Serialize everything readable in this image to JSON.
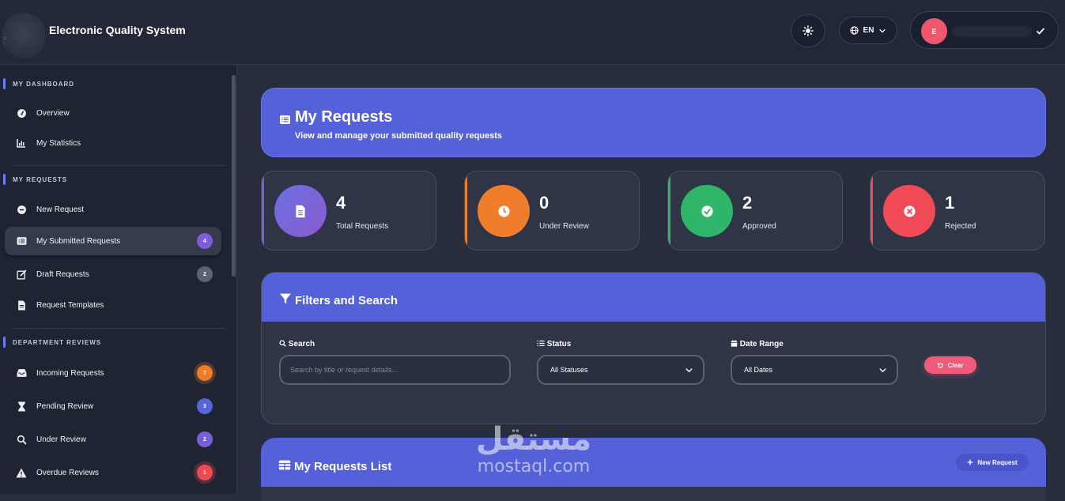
{
  "header": {
    "app_title": "Electronic Quality System",
    "language": "EN",
    "user_initial": "E"
  },
  "sidebar": {
    "sections": [
      {
        "title": "MY DASHBOARD"
      },
      {
        "title": "MY REQUESTS"
      },
      {
        "title": "DEPARTMENT REVIEWS"
      }
    ],
    "items": [
      {
        "label": "Overview",
        "icon": "gauge-icon"
      },
      {
        "label": "My Statistics",
        "icon": "bar-chart-icon"
      },
      {
        "label": "New Request",
        "icon": "plus-circle-icon"
      },
      {
        "label": "My Submitted Requests",
        "icon": "list-icon",
        "badge": "4",
        "active": true
      },
      {
        "label": "Draft Requests",
        "icon": "edit-icon",
        "badge": "2"
      },
      {
        "label": "Request Templates",
        "icon": "file-icon"
      },
      {
        "label": "Incoming Requests",
        "icon": "inbox-icon",
        "badge": "7"
      },
      {
        "label": "Pending Review",
        "icon": "hourglass-icon",
        "badge": "3"
      },
      {
        "label": "Under Review",
        "icon": "search-icon",
        "badge": "2"
      },
      {
        "label": "Overdue Reviews",
        "icon": "warning-icon",
        "badge": "1"
      }
    ],
    "badge_colors": {
      "purple": "#7b5fd6",
      "gray": "#5b6275",
      "orange": "#f07c2a",
      "indigo": "#5765d8",
      "violet": "#7a5fd3",
      "red": "#ef4a52"
    }
  },
  "banner": {
    "title": "My Requests",
    "subtitle": "View and manage your submitted quality requests"
  },
  "stats": [
    {
      "value": "4",
      "label": "Total Requests",
      "color": "#7b5fd6",
      "icon": "document-icon"
    },
    {
      "value": "0",
      "label": "Under Review",
      "color": "#f07c2a",
      "icon": "clock-icon"
    },
    {
      "value": "2",
      "label": "Approved",
      "color": "#2fb66a",
      "icon": "check-circle-icon"
    },
    {
      "value": "1",
      "label": "Rejected",
      "color": "#ef4a55",
      "icon": "x-circle-icon"
    }
  ],
  "filters": {
    "title": "Filters and Search",
    "search_label": "Search",
    "search_placeholder": "Search by title or request details...",
    "status_label": "Status",
    "status_value": "All Statuses",
    "date_label": "Date Range",
    "date_value": "All Dates",
    "clear_label": "Clear"
  },
  "list": {
    "title": "My Requests List",
    "new_request_label": "New Request"
  },
  "watermark": {
    "arabic": "مستقل",
    "latin": "mostaql.com"
  },
  "colors": {
    "primary": "#5561d9",
    "background": "#272d3d",
    "card": "#2f3546",
    "danger": "#f05b79"
  }
}
